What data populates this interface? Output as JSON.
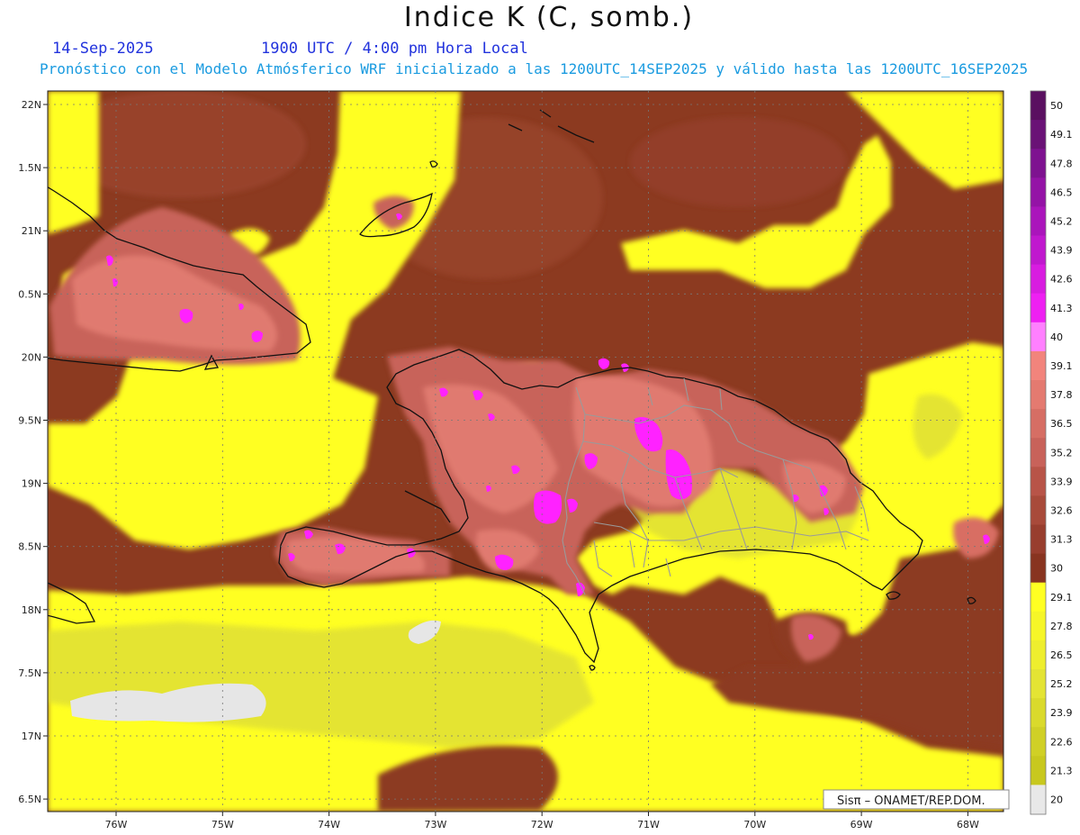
{
  "header": {
    "title": "Indice K (C, somb.)",
    "date": "14-Sep-2025",
    "time": "1900 UTC / 4:00 pm Hora Local",
    "subtitle": "Pronóstico con el Modelo Atmósferico WRF inicializado a las 1200UTC_14SEP2025 y válido hasta las  1200UTC_16SEP2025"
  },
  "axes": {
    "lat_labels": [
      "22N",
      "1.5N",
      "21N",
      "0.5N",
      "20N",
      "9.5N",
      "19N",
      "8.5N",
      "18N",
      "7.5N",
      "17N",
      "6.5N"
    ],
    "lon_labels": [
      "76W",
      "75W",
      "74W",
      "73W",
      "72W",
      "71W",
      "70W",
      "69W",
      "68W"
    ]
  },
  "colorbar": {
    "labels": [
      "50",
      "49.1",
      "47.8",
      "46.5",
      "45.2",
      "43.9",
      "42.6",
      "41.3",
      "40",
      "39.1",
      "37.8",
      "36.5",
      "35.2",
      "33.9",
      "32.6",
      "31.3",
      "30",
      "29.1",
      "27.8",
      "26.5",
      "25.2",
      "23.9",
      "22.6",
      "21.3",
      "20"
    ],
    "colors": [
      "#5a1060",
      "#6a1276",
      "#7e1290",
      "#9413a6",
      "#aa15bb",
      "#c018ce",
      "#d81ce0",
      "#ee20f2",
      "#ff80ff",
      "#f2847c",
      "#e47a70",
      "#d66e64",
      "#c8625a",
      "#b85448",
      "#a84a3a",
      "#983e2e",
      "#883420",
      "#ffff22",
      "#f6f628",
      "#eeee2e",
      "#e4e434",
      "#dada2c",
      "#d0d026",
      "#c8c81e",
      "#e8e8e8"
    ]
  },
  "credit": {
    "text": "Sisπ – ONAMET/REP.DOM."
  },
  "palette": {
    "background": "#8c3a20",
    "yellow": "#ffff24",
    "pale_yellow": "#e4e432",
    "rose": "#c8645a",
    "pink": "#e07a70",
    "magenta": "#ff22ff",
    "coast": "#111111",
    "borders": "#9a9a9a"
  }
}
